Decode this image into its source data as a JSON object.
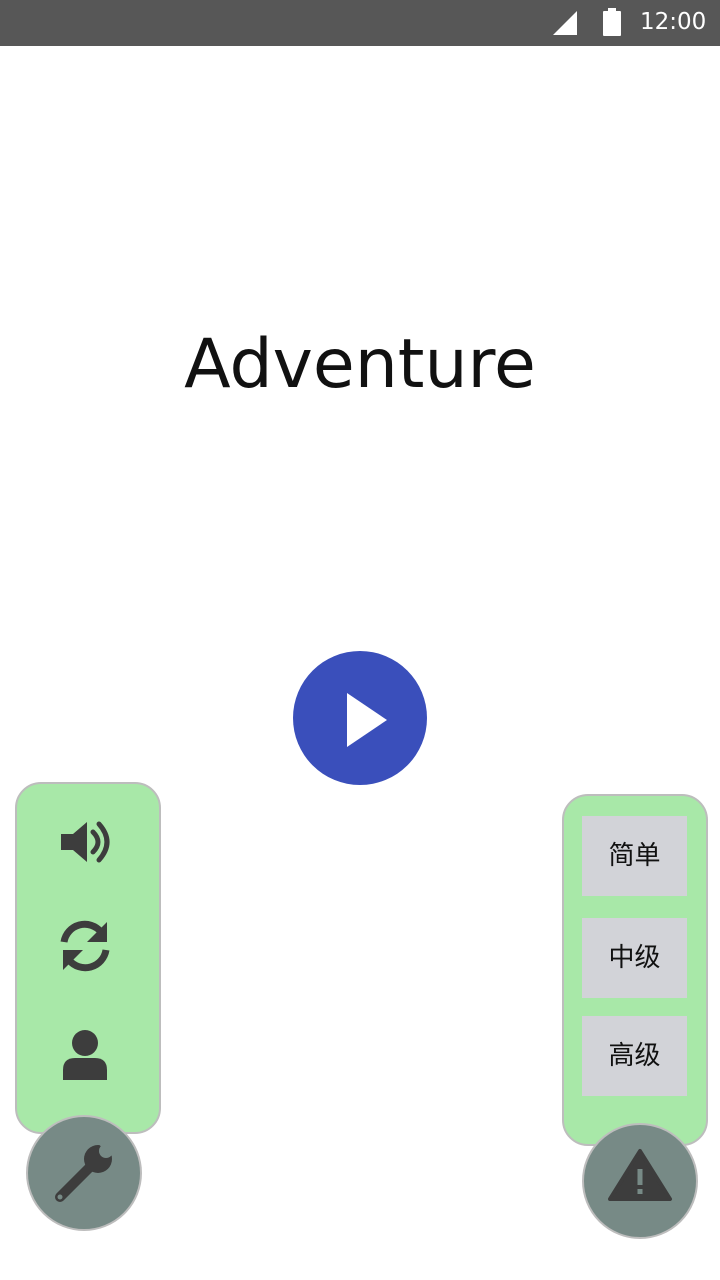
{
  "status_bar": {
    "time": "12:00",
    "icons": [
      "signal-icon",
      "battery-icon"
    ]
  },
  "title": "Adventure",
  "play_button": {
    "icon": "play-icon",
    "color": "#3a4fbb"
  },
  "settings_panel": {
    "color": "#a8e8a8",
    "items": [
      {
        "icon": "volume-icon"
      },
      {
        "icon": "refresh-icon"
      },
      {
        "icon": "user-icon"
      }
    ]
  },
  "settings_fab": {
    "icon": "wrench-icon",
    "color": "#778a86"
  },
  "difficulty_panel": {
    "color": "#a8e8a8",
    "levels": [
      {
        "label": "简单"
      },
      {
        "label": "中级"
      },
      {
        "label": "高级"
      }
    ]
  },
  "warning_fab": {
    "icon": "warning-icon",
    "color": "#778a86"
  }
}
